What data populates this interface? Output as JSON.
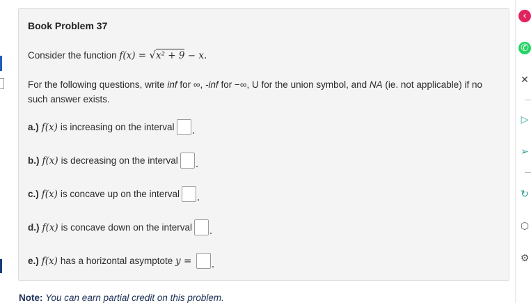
{
  "problem": {
    "title": "Book Problem 37",
    "statement_prefix": "Consider the function",
    "function_lhs": "f(x) = ",
    "radicand": "x² + 9",
    "function_tail": " − x.",
    "instructions": {
      "p1": "For the following questions, write ",
      "inf": "inf",
      "p2": " for ∞, ",
      "neginf": "-inf",
      "p3": " for −∞, U for the union symbol, and ",
      "na": "NA",
      "p4": " (ie. not applicable) if no such answer exists."
    },
    "questions": [
      {
        "label": "a.)",
        "fx": "f(x)",
        "text": "is increasing on the interval",
        "value": ""
      },
      {
        "label": "b.)",
        "fx": "f(x)",
        "text": "is decreasing on the interval",
        "value": ""
      },
      {
        "label": "c.)",
        "fx": "f(x)",
        "text": "is concave up on the interval",
        "value": ""
      },
      {
        "label": "d.)",
        "fx": "f(x)",
        "text": "is concave down on the interval",
        "value": ""
      },
      {
        "label": "e.)",
        "fx": "f(x)",
        "text": "has a horizontal asymptote",
        "eq": "y =",
        "value": ""
      }
    ]
  },
  "note": {
    "label": "Note:",
    "text": "You can earn partial credit on this problem."
  },
  "sidebar": {
    "icons": [
      "chevron-icon",
      "whatsapp-icon",
      "close-icon",
      "play-icon",
      "send-icon",
      "refresh-icon",
      "cube-icon",
      "settings-icon"
    ]
  },
  "colors": {
    "card_bg": "#f4f4f4",
    "note_text": "#1b2f55",
    "accent": "#1f5fbf"
  }
}
